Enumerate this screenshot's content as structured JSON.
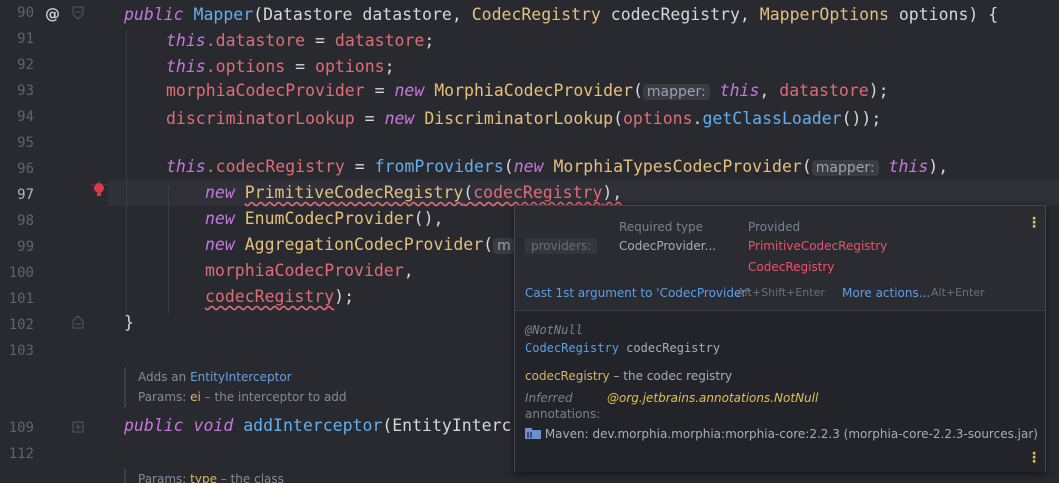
{
  "line_numbers": [
    "90",
    "91",
    "92",
    "93",
    "94",
    "95",
    "96",
    "97",
    "98",
    "99",
    "100",
    "101",
    "102",
    "103",
    "109",
    "112"
  ],
  "code": {
    "l90": {
      "kw1": "public",
      "type": "Mapper",
      "p1": "(Datastore datastore, ",
      "t2": "CodecRegistry",
      "p2": " codecRegistry, ",
      "t3": "MapperOptions",
      "p3": " options) {"
    },
    "l91": {
      "this": "this",
      "f": ".datastore",
      "rest": " = ",
      "v": "datastore",
      ";": ";"
    },
    "l92": {
      "this": "this",
      "f": ".options",
      "rest": " = ",
      "v": "options",
      ";": ";"
    },
    "l93": {
      "f": "morphiaCodecProvider",
      "eq": " = ",
      "new": "new",
      "cls": "MorphiaCodecProvider",
      "op": "(",
      "hint": "mapper:",
      "this": "this",
      ", ": ", ",
      "v": "datastore",
      "end": ");"
    },
    "l94": {
      "f": "discriminatorLookup",
      "eq": " = ",
      "new": "new",
      "cls": "DiscriminatorLookup",
      "op": "(",
      "v": "options",
      "dot": ".",
      "m": "getClassLoader",
      "end": "());"
    },
    "l96": {
      "this": "this",
      "f": ".codecRegistry",
      "eq": " = ",
      "m": "fromProviders",
      "op": "(",
      "new": "new",
      "cls": "MorphiaTypesCodecProvider",
      "op2": "(",
      "hint": "mapper:",
      "this2": "this",
      "end": "),"
    },
    "l97": {
      "new": "new",
      "cls": "PrimitiveCodecRegistry",
      "op": "(",
      "v": "codecRegistry",
      "end": "),"
    },
    "l98": {
      "new": "new",
      "cls": "EnumCodecProvider",
      "end": "(),"
    },
    "l99": {
      "new": "new",
      "cls": "AggregationCodecProvider",
      "op": "(",
      "hint": "m"
    },
    "l100": {
      "f": "morphiaCodecProvider",
      "end": ","
    },
    "l101": {
      "v": "codecRegistry",
      "end": ");"
    },
    "l102": {
      "brace": "}"
    },
    "l109": {
      "kw1": "public",
      "kw2": "void",
      "m": "addInterceptor",
      "p": "(EntityInterc"
    }
  },
  "doc1": {
    "l1_pre": "Adds an ",
    "l1_ref": "EntityInterceptor",
    "l2_pre": "Params: ",
    "l2_b": "ei",
    "l2_post": " – the interceptor to add"
  },
  "doc2": {
    "l1_pre": "Params: ",
    "l1_b": "type",
    "l1_post": " – the class"
  },
  "popup": {
    "required_type_header": "Required type",
    "provided_header": "Provided",
    "row_label": "providers:",
    "required_value": "CodecProvider...",
    "provided_1": "PrimitiveCodecRegistry",
    "provided_2": "CodecRegistry",
    "fix_action": "Cast 1st argument to 'CodecProvider'",
    "fix_shortcut": "Alt+Shift+Enter",
    "more_actions": "More actions...",
    "more_shortcut": "Alt+Enter",
    "annotation": "@NotNull",
    "decl_type": "CodecRegistry",
    "decl_name": " codecRegistry",
    "param_name": "codecRegistry",
    "param_desc": " – the codec registry",
    "inferred_label": "Inferred",
    "inferred_value": "@org.jetbrains.annotations.NotNull",
    "annotations_label": "annotations:",
    "maven_text": "Maven: dev.morphia.morphia:morphia-core:2.2.3 (morphia-core-2.2.3-sources.jar)"
  },
  "colors": {
    "keyword": "#c678dd",
    "type": "#e5c07b",
    "field": "#e06c75",
    "method": "#61afef",
    "error": "#f0506e",
    "link": "#5d9ee8",
    "kebab": "#e6c14d"
  }
}
